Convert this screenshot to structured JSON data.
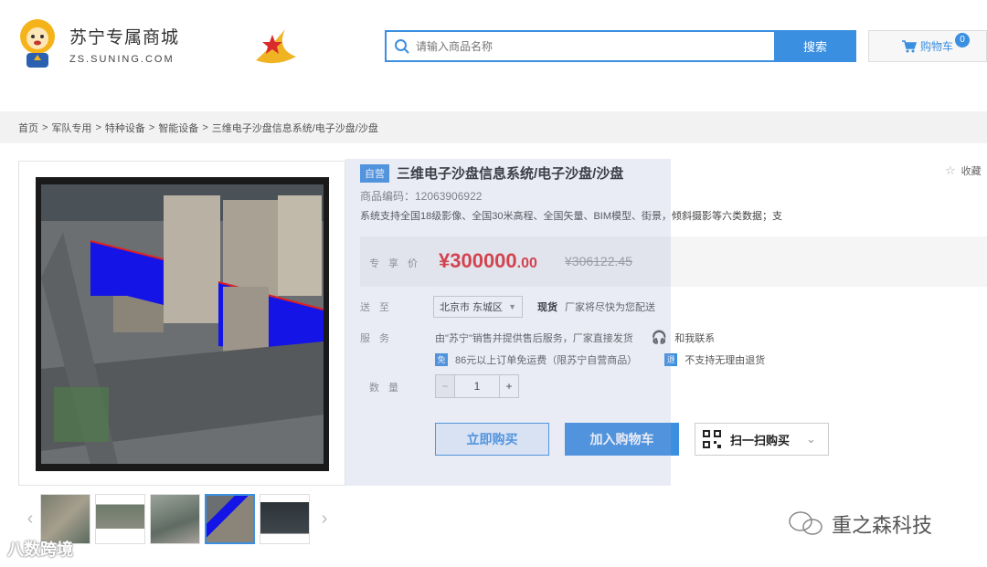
{
  "header": {
    "logo_title": "苏宁专属商城",
    "logo_sub": "ZS.SUNING.COM",
    "search_placeholder": "请输入商品名称",
    "search_button": "搜索",
    "cart_label": "购物车",
    "cart_count": "0"
  },
  "breadcrumb": [
    "首页",
    ">",
    "军队专用",
    ">",
    "特种设备",
    ">",
    "智能设备",
    ">",
    "三维电子沙盘信息系统/电子沙盘/沙盘"
  ],
  "product": {
    "tag": "自营",
    "title": "三维电子沙盘信息系统/电子沙盘/沙盘",
    "favorite": "收藏",
    "code": "商品编码：12063906922",
    "description": "系统支持全国18级影像、全国30米高程、全国矢量、BIM模型、街景，倾斜摄影等六类数据；支",
    "price_label": "专享价",
    "price_int": "¥300000",
    "price_dec": ".00",
    "old_price": "¥306122.45",
    "ship_label": "送至",
    "ship_location": "北京市 东城区",
    "stock": "现货",
    "stock_note": "厂家将尽快为您配送",
    "service_label": "服务",
    "service_text": "由\"苏宁\"销售并提供售后服务，厂家直接发货",
    "contact": "和我联系",
    "free_ship_icon": "免",
    "free_ship": "86元以上订单免运费（限苏宁自营商品）",
    "return_icon": "退",
    "return_text": "不支持无理由退货",
    "qty_label": "数量",
    "qty_minus": "−",
    "qty_value": "1",
    "qty_plus": "+",
    "buy_now": "立即购买",
    "add_cart": "加入购物车",
    "scan_buy": "扫一扫购买"
  },
  "gallery": {
    "prev": "‹",
    "next": "›",
    "thumb_count": 5,
    "active_index": 3
  },
  "watermarks": {
    "wechat": "重之森科技",
    "corner": "八数跨境"
  }
}
